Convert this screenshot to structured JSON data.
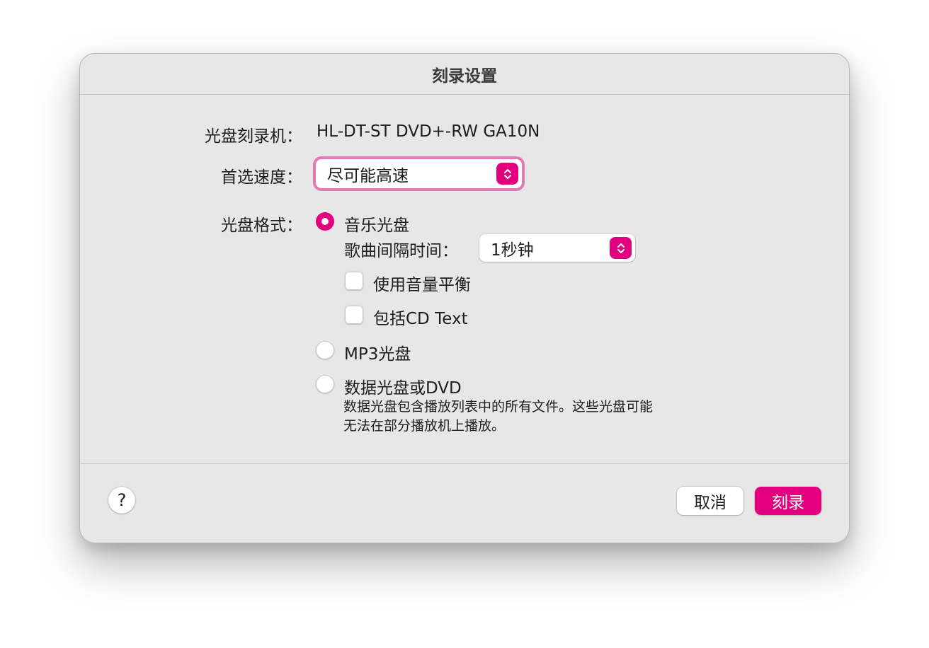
{
  "dialog": {
    "title": "刻录设置",
    "burner": {
      "label": "光盘刻录机：",
      "value": "HL-DT-ST DVD+-RW GA10N"
    },
    "speed": {
      "label": "首选速度：",
      "selected": "尽可能高速"
    },
    "format": {
      "label": "光盘格式：",
      "audio_cd": {
        "label": "音乐光盘",
        "selected": true,
        "gap_label": "歌曲间隔时间：",
        "gap_selected": "1秒钟",
        "sound_check_label": "使用音量平衡",
        "sound_check_checked": false,
        "cd_text_label": "包括CD Text",
        "cd_text_checked": false
      },
      "mp3_cd": {
        "label": "MP3光盘",
        "selected": false
      },
      "data_disc": {
        "label": "数据光盘或DVD",
        "selected": false,
        "description_line1": "数据光盘包含播放列表中的所有文件。这些光盘可能",
        "description_line2": "无法在部分播放机上播放。"
      }
    },
    "help_label": "?",
    "cancel_label": "取消",
    "burn_label": "刻录"
  },
  "colors": {
    "accent": "#e3007e",
    "focus_ring": "#e27bb5",
    "background": "#e8e7e8"
  }
}
